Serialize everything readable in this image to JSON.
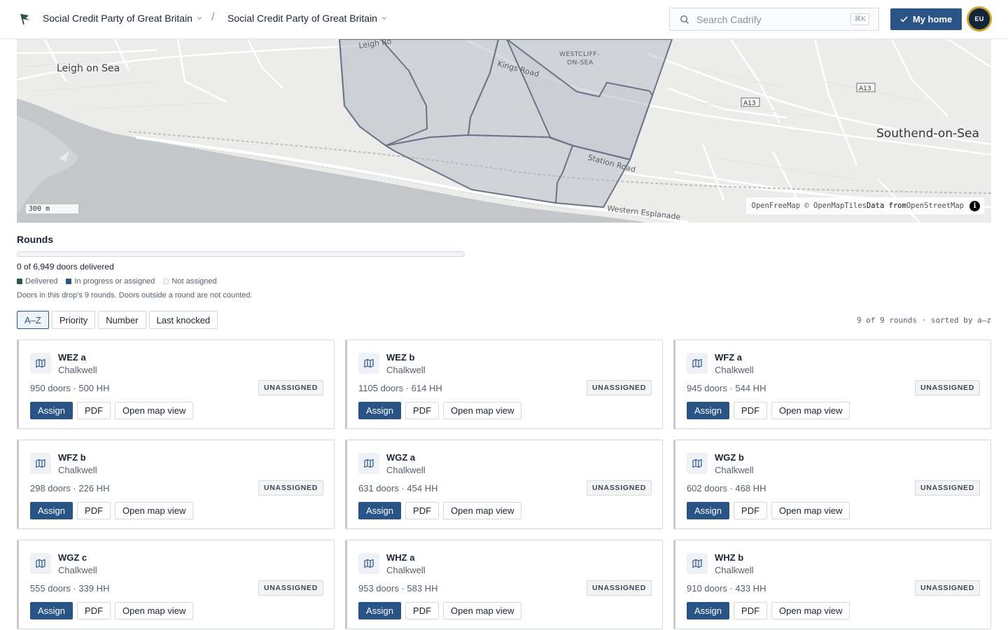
{
  "header": {
    "org_name": "Social Credit Party of Great Britain",
    "crumb_separator": "/",
    "workspace_name": "Social Credit Party of Great Britain",
    "search_placeholder": "Search Cadrify",
    "search_shortcut": "⌘K",
    "home_button": "My home",
    "avatar_initials": "EU",
    "accent_color": "#2b5486"
  },
  "map": {
    "labels": {
      "leigh": "Leigh on Sea",
      "southend": "Southend-on-Sea",
      "westcliff_1": "WESTCLIFF-",
      "westcliff_2": "ON-SEA",
      "kings_road": "Kings Road",
      "station_road": "Station Road",
      "western_esplanade": "Western Esplanade",
      "leigh_road": "Leigh Ro",
      "a13_1": "A13",
      "a13_2": "A13"
    },
    "scale_label": "300 m",
    "attribution": {
      "part1": "OpenFreeMap © OpenMapTiles ",
      "part2": "Data from ",
      "part3": "OpenStreetMap",
      "info_icon": "i"
    }
  },
  "rounds": {
    "title": "Rounds",
    "progress_fraction": 0,
    "delivered_text": "0 of 6,949 doors delivered",
    "legend": [
      {
        "label": "Delivered",
        "color": "#2e5744"
      },
      {
        "label": "In progress or assigned",
        "color": "#2b5486"
      },
      {
        "label": "Not assigned",
        "color": "#f4f5f7"
      }
    ],
    "note": "Doors in this drop's 9 rounds. Doors outside a round are not counted.",
    "sort_options": [
      "A–Z",
      "Priority",
      "Number",
      "Last knocked"
    ],
    "active_sort": "A–Z",
    "count_text": "9 of 9 rounds · sorted by a–z",
    "action_labels": {
      "assign": "Assign",
      "pdf": "PDF",
      "map": "Open map view"
    },
    "items": [
      {
        "name": "WEZ a",
        "area": "Chalkwell",
        "stats": "950 doors · 500 HH",
        "status": "UNASSIGNED"
      },
      {
        "name": "WEZ b",
        "area": "Chalkwell",
        "stats": "1105 doors · 614 HH",
        "status": "UNASSIGNED"
      },
      {
        "name": "WFZ a",
        "area": "Chalkwell",
        "stats": "945 doors · 544 HH",
        "status": "UNASSIGNED"
      },
      {
        "name": "WFZ b",
        "area": "Chalkwell",
        "stats": "298 doors · 226 HH",
        "status": "UNASSIGNED"
      },
      {
        "name": "WGZ a",
        "area": "Chalkwell",
        "stats": "631 doors · 454 HH",
        "status": "UNASSIGNED"
      },
      {
        "name": "WGZ b",
        "area": "Chalkwell",
        "stats": "602 doors · 468 HH",
        "status": "UNASSIGNED"
      },
      {
        "name": "WGZ c",
        "area": "Chalkwell",
        "stats": "555 doors · 339 HH",
        "status": "UNASSIGNED"
      },
      {
        "name": "WHZ a",
        "area": "Chalkwell",
        "stats": "953 doors · 583 HH",
        "status": "UNASSIGNED"
      },
      {
        "name": "WHZ b",
        "area": "Chalkwell",
        "stats": "910 doors · 433 HH",
        "status": "UNASSIGNED"
      }
    ]
  }
}
